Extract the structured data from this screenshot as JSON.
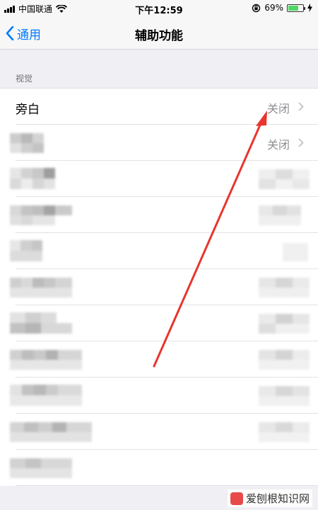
{
  "status_bar": {
    "carrier": "中国联通",
    "time": "下午12:59",
    "battery_percent": "69%",
    "battery_level": 0.69
  },
  "nav": {
    "back_label": "通用",
    "title": "辅助功能"
  },
  "section": {
    "header": "视觉"
  },
  "rows": [
    {
      "label": "旁白",
      "value": "关闭"
    },
    {
      "label": "",
      "value": "关闭"
    }
  ],
  "watermark": {
    "text": "爱刨根知识网"
  },
  "colors": {
    "accent": "#007aff",
    "annotation_arrow": "#e8352e",
    "battery": "#4cd964"
  }
}
